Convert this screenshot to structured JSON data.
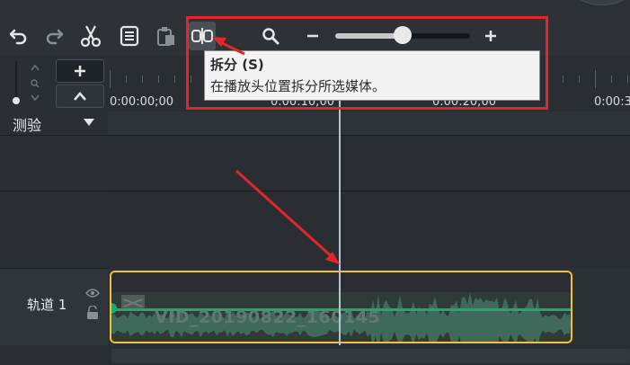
{
  "toolbar": {
    "buttons": [
      "undo-icon",
      "redo-icon",
      "cut-icon",
      "copy-icon",
      "paste-icon",
      "split-icon"
    ],
    "zoom": {
      "level": 0.5
    }
  },
  "tooltip": {
    "title": "拆分 (S)",
    "description": "在播放头位置拆分所选媒体。"
  },
  "ruler": {
    "labels": [
      "0:00:00;00",
      "0:00:10;00",
      "0:00:20;00",
      "0:00:3"
    ]
  },
  "tracks": [
    {
      "name": "测验"
    },
    {
      "name": "轨道 1"
    }
  ],
  "clip": {
    "title": "VID_20190822_160145"
  },
  "colors": {
    "annotation": "#e0272a",
    "clip_border": "#f2c03a",
    "audio": "#21a86a"
  }
}
